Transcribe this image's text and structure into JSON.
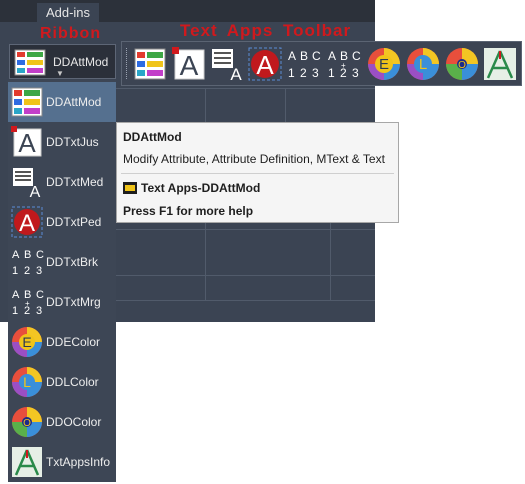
{
  "tab": {
    "label": "Add-ins"
  },
  "annotations": {
    "ribbon": "Ribbon",
    "toolbar": "Text  Apps Toolbar"
  },
  "split_button": {
    "label": "DDAttMod"
  },
  "menu": {
    "items": [
      {
        "label": "DDAttMod",
        "icon": "ddattmod-icon",
        "selected": true
      },
      {
        "label": "DDTxtJus",
        "icon": "ddtxtjus-icon"
      },
      {
        "label": "DDTxtMed",
        "icon": "ddtxtmed-icon"
      },
      {
        "label": "DDTxtPed",
        "icon": "ddtxtped-icon"
      },
      {
        "label": "DDTxtBrk",
        "icon": "ddtxtbrk-icon"
      },
      {
        "label": "DDTxtMrg",
        "icon": "ddtxtmrg-icon"
      },
      {
        "label": "DDEColor",
        "icon": "ddecolor-icon"
      },
      {
        "label": "DDLColor",
        "icon": "ddlcolor-icon"
      },
      {
        "label": "DDOColor",
        "icon": "ddocolor-icon"
      },
      {
        "label": "TxtAppsInfo",
        "icon": "txtappsinfo-icon"
      }
    ]
  },
  "tooltip": {
    "title": "DDAttMod",
    "description": "Modify Attribute, Attribute Definition, MText & Text",
    "source": "Text Apps-DDAttMod",
    "help": "Press F1 for more help"
  },
  "glyphs": {
    "a": "A",
    "b": "B",
    "c": "C",
    "d1": "1",
    "d2": "2",
    "d3": "3",
    "e": "E",
    "l": "L",
    "o": "O"
  },
  "colors": {
    "annotation_red": "#d0191d",
    "panel": "#3b4453",
    "selected": "#55708f",
    "tooltip_bg": "#f5f5f5"
  }
}
